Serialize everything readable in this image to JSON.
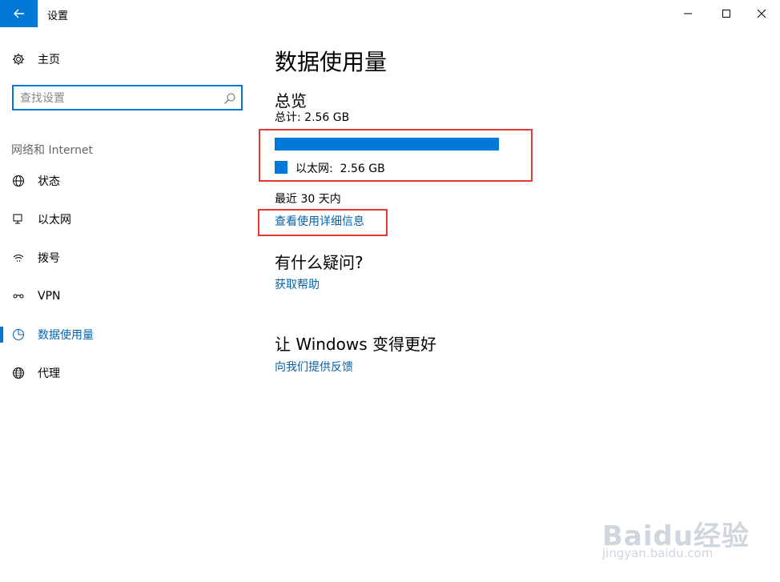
{
  "window": {
    "title": "设置",
    "back_icon": "arrow-left-icon",
    "minimize_icon": "minimize-icon",
    "maximize_icon": "maximize-icon",
    "close_icon": "close-icon",
    "accent_color": "#0078d7"
  },
  "sidebar": {
    "home": {
      "label": "主页",
      "icon": "gear-icon"
    },
    "search": {
      "placeholder": "查找设置",
      "value": "",
      "icon": "search-icon"
    },
    "section_label": "网络和 Internet",
    "items": [
      {
        "label": "状态",
        "icon": "globe-status-icon",
        "active": false
      },
      {
        "label": "以太网",
        "icon": "ethernet-icon",
        "active": false
      },
      {
        "label": "拨号",
        "icon": "dialup-icon",
        "active": false
      },
      {
        "label": "VPN",
        "icon": "vpn-icon",
        "active": false
      },
      {
        "label": "数据使用量",
        "icon": "pie-chart-icon",
        "active": true
      },
      {
        "label": "代理",
        "icon": "globe-icon",
        "active": false
      }
    ]
  },
  "main": {
    "title": "数据使用量",
    "overview": {
      "heading": "总览",
      "total": "总计: 2.56 GB",
      "usage_fraction": 1.0,
      "legend_label": "以太网:",
      "legend_value": "2.56 GB",
      "period": "最近 30 天内",
      "details_link": "查看使用详细信息"
    },
    "questions": {
      "heading": "有什么疑问?",
      "link": "获取帮助"
    },
    "improve": {
      "heading": "让 Windows 变得更好",
      "link": "向我们提供反馈"
    }
  },
  "annotations": {
    "highlight_color": "#e53935"
  },
  "watermark": {
    "text": "Baidu经验",
    "sub": "jingyan.baidu.com"
  }
}
